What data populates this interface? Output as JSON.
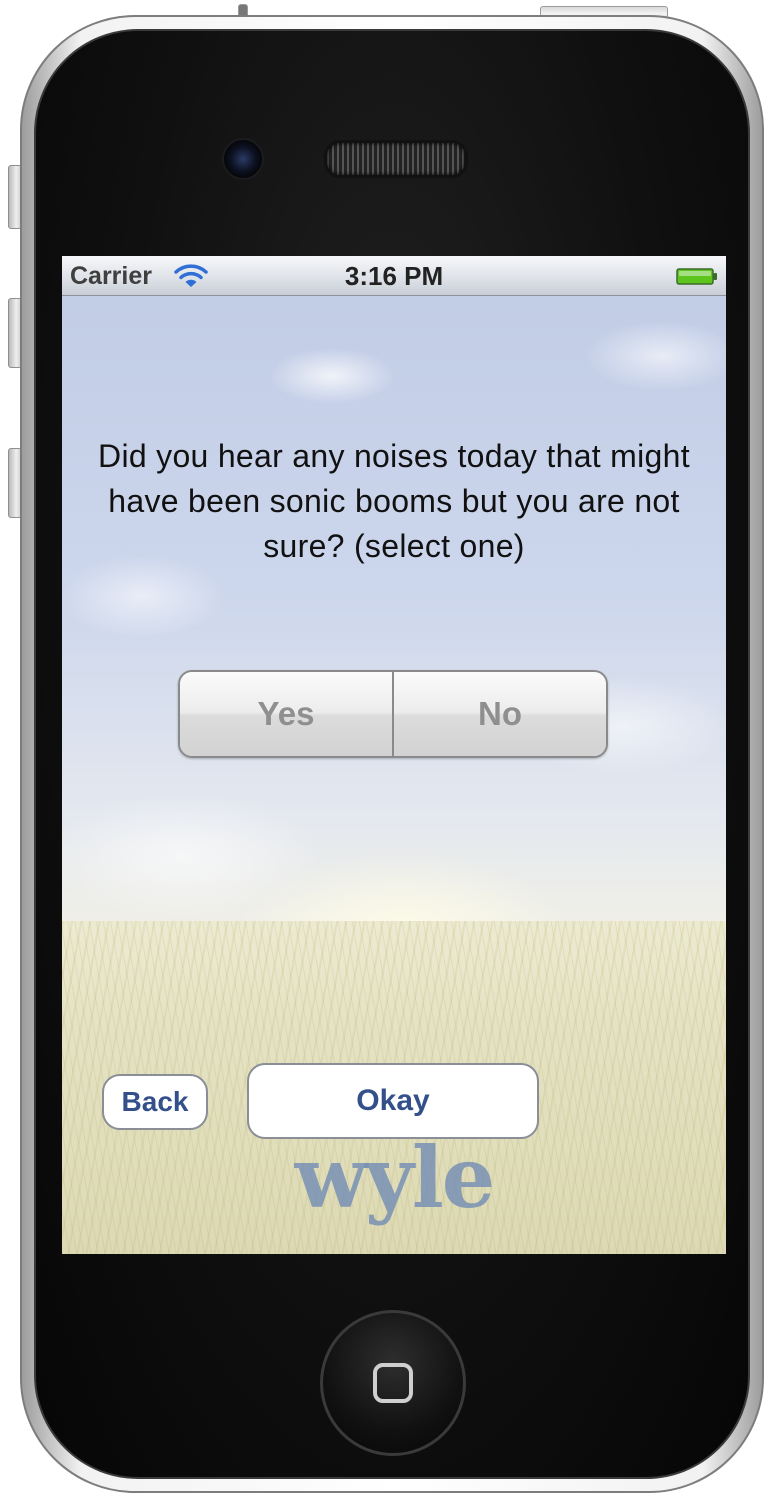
{
  "status_bar": {
    "carrier": "Carrier",
    "time": "3:16 PM",
    "wifi_icon": "wifi-icon",
    "battery_icon": "battery-icon",
    "battery_color": "#5ec41e"
  },
  "survey": {
    "question": "Did you hear any noises today that might have been sonic booms but you are not sure? (select one)",
    "options": [
      "Yes",
      "No"
    ],
    "selected": null
  },
  "actions": {
    "back_label": "Back",
    "okay_label": "Okay"
  },
  "branding": {
    "logo_text": "wyle"
  },
  "colors": {
    "button_text": "#34508a",
    "segment_text": "#8f8f8f"
  },
  "device": {
    "home_button_icon": "home-square-icon"
  }
}
